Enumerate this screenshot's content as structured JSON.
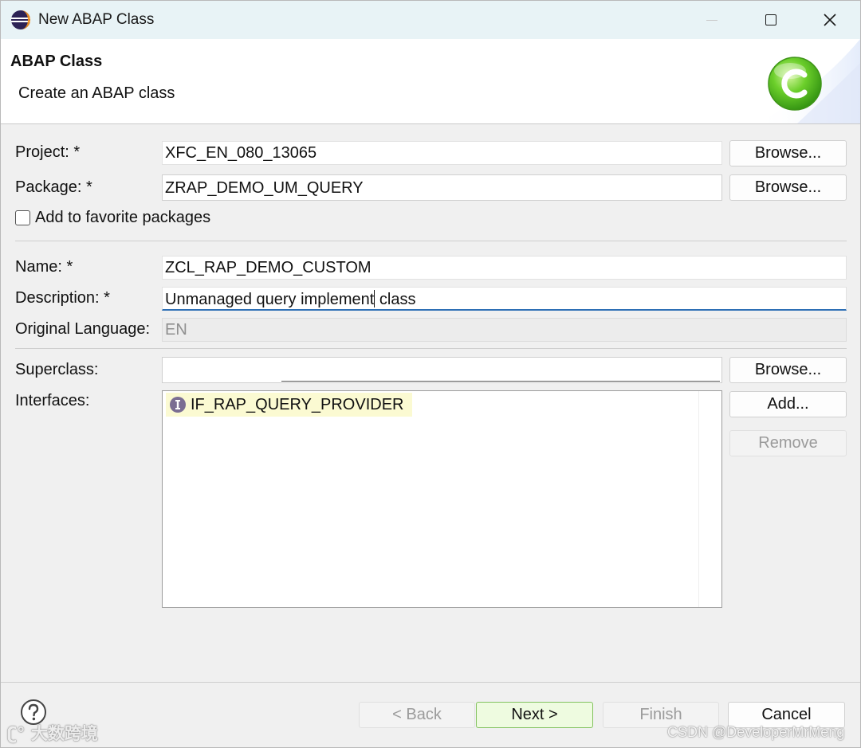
{
  "window": {
    "title": "New ABAP Class",
    "app_icon": "eclipse-icon"
  },
  "header": {
    "title": "ABAP Class",
    "subtitle": "Create an ABAP class",
    "icon": "class-c-icon"
  },
  "form": {
    "project": {
      "label": "Project: *",
      "value": "XFC_EN_080_13065",
      "browse_label": "Browse..."
    },
    "package": {
      "label": "Package: *",
      "value": "ZRAP_DEMO_UM_QUERY",
      "browse_label": "Browse..."
    },
    "favorite": {
      "label": "Add to favorite packages",
      "checked": false
    },
    "name": {
      "label": "Name: *",
      "value": "ZCL_RAP_DEMO_CUSTOM"
    },
    "description": {
      "label": "Description: *",
      "value_before_caret": "Unmanaged query implement",
      "value_after_caret": " class"
    },
    "original_language": {
      "label": "Original Language:",
      "value": "EN"
    },
    "superclass": {
      "label": "Superclass:",
      "value": "",
      "browse_label": "Browse..."
    },
    "interfaces": {
      "label": "Interfaces:",
      "items": [
        "IF_RAP_QUERY_PROVIDER"
      ],
      "add_label": "Add...",
      "remove_label": "Remove"
    }
  },
  "footer": {
    "help_icon": "help-icon",
    "back_label": "< Back",
    "next_label": "Next >",
    "finish_label": "Finish",
    "cancel_label": "Cancel"
  },
  "watermarks": {
    "left": "大数跨境",
    "right": "CSDN @DeveloperMrMeng"
  },
  "colors": {
    "title_bar": "#e8f3f6",
    "dialog_bg": "#f0f0f0",
    "focus_underline": "#2d6fb5",
    "default_button_border": "#82c25e",
    "interface_highlight": "#fbfad2"
  }
}
